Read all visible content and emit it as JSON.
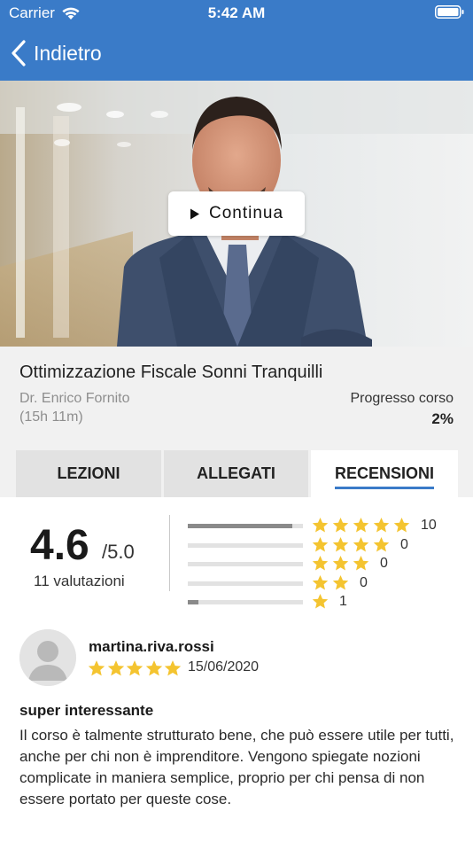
{
  "status_bar": {
    "carrier": "Carrier",
    "time": "5:42 AM"
  },
  "nav": {
    "back_label": "Indietro"
  },
  "hero": {
    "continue_label": "Continua"
  },
  "course": {
    "title": "Ottimizzazione Fiscale Sonni Tranquilli",
    "author": "Dr. Enrico Fornito",
    "duration": "(15h 11m)",
    "progress_label": "Progresso corso",
    "progress_value": "2%",
    "progress_fraction": 0.02
  },
  "tabs": [
    {
      "label": "LEZIONI",
      "active": false
    },
    {
      "label": "ALLEGATI",
      "active": false
    },
    {
      "label": "RECENSIONI",
      "active": true
    }
  ],
  "rating": {
    "score": "4.6",
    "max": "/5.0",
    "count_label": "11 valutazioni",
    "breakdown": [
      {
        "stars": 5,
        "count": "10",
        "fraction": 0.91
      },
      {
        "stars": 4,
        "count": "0",
        "fraction": 0
      },
      {
        "stars": 3,
        "count": "0",
        "fraction": 0
      },
      {
        "stars": 2,
        "count": "0",
        "fraction": 0
      },
      {
        "stars": 1,
        "count": "1",
        "fraction": 0.09
      }
    ]
  },
  "review": {
    "username": "martina.riva.rossi",
    "stars": 5,
    "date": "15/06/2020",
    "title": "super interessante",
    "body": "Il corso è talmente strutturato bene, che può essere utile per tutti, anche per chi non è imprenditore. Vengono spiegate nozioni complicate in maniera semplice, proprio per chi pensa di non essere portato per queste cose."
  },
  "colors": {
    "brand": "#3a7bc8",
    "star": "#f4c430",
    "tab_inactive": "#e2e2e2"
  },
  "icons": {
    "back": "chevron-left-icon",
    "play": "play-icon",
    "wifi": "wifi-icon",
    "battery": "battery-icon",
    "star": "star-icon",
    "avatar": "user-avatar-icon"
  }
}
